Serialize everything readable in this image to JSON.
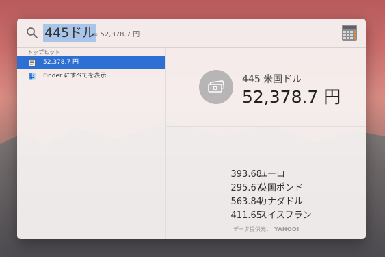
{
  "search": {
    "query": "445ドル",
    "inline_result": "= 52,378.7 円"
  },
  "sidebar": {
    "section_label": "トップヒット",
    "items": [
      {
        "label": "52,378.7 円",
        "selected": true
      },
      {
        "label": "Finder にすべてを表示..."
      }
    ]
  },
  "detail": {
    "source_amount": "445 米国ドル",
    "result": "52,378.7 円",
    "conversions": [
      {
        "value": "393.68",
        "currency": "ユーロ"
      },
      {
        "value": "295.67",
        "currency": "英国ポンド"
      },
      {
        "value": "563.84",
        "currency": "カナダドル"
      },
      {
        "value": "411.65",
        "currency": "スイスフラン"
      }
    ],
    "footer_label": "データ提供元：",
    "footer_provider": "YAHOO!"
  },
  "colors": {
    "selection": "#2e6fd4",
    "query_highlight": "#a9c5ea",
    "badge": "#b7b5b5"
  },
  "icons": [
    "search-icon",
    "calculator-icon",
    "document-icon",
    "finder-icon",
    "money-icon"
  ]
}
